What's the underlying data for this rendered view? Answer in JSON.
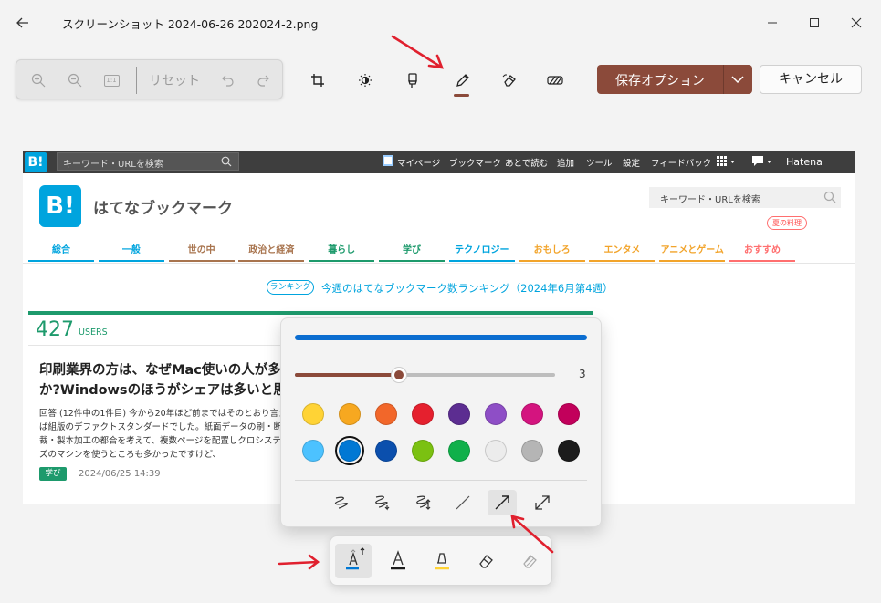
{
  "window": {
    "title": "スクリーンショット 2024-06-26 202024-2.png"
  },
  "zoom_bar": {
    "reset_label": "リセット",
    "fit_label": "1:1"
  },
  "toolbar": {
    "tools": [
      "crop-icon",
      "brightness-icon",
      "marker-icon",
      "pen-icon",
      "eraser-icon",
      "redact-icon"
    ],
    "save_label": "保存オプション",
    "cancel_label": "キャンセル",
    "accent": "#8b4a3a"
  },
  "page": {
    "header": {
      "logo": "B!",
      "search_placeholder": "キーワード・URLを検索",
      "links": [
        "マイページ",
        "ブックマーク",
        "あとで読む",
        "追加",
        "ツール",
        "設定",
        "フィードバック",
        "Hatena"
      ]
    },
    "site_logo": "B!",
    "site_title": "はてなブックマーク",
    "site_search": "キーワード・URLを検索",
    "categories": [
      {
        "label": "総合",
        "color": "#00a4de"
      },
      {
        "label": "一般",
        "color": "#00a4de"
      },
      {
        "label": "世の中",
        "color": "#a8744e"
      },
      {
        "label": "政治と経済",
        "color": "#a8744e"
      },
      {
        "label": "暮らし",
        "color": "#1d9a6c"
      },
      {
        "label": "学び",
        "color": "#1d9a6c"
      },
      {
        "label": "テクノロジー",
        "color": "#00a4de"
      },
      {
        "label": "おもしろ",
        "color": "#f2a42b"
      },
      {
        "label": "エンタメ",
        "color": "#f2a42b"
      },
      {
        "label": "アニメとゲーム",
        "color": "#f2a42b"
      },
      {
        "label": "おすすめ",
        "color": "#ff6f6f"
      }
    ],
    "category_badge": "夏の料理",
    "ranking_badge": "ランキング",
    "ranking_text": "今週のはてなブックマーク数ランキング（2024年6月第4週）",
    "article": {
      "users": "427",
      "users_label": "USERS",
      "title": "印刷業界の方は、なぜMac使いの人が多いのか?Windowsのほうがシェアは多いと思",
      "body": "回答 (12件中の1件目) 今から20年ほど前まではそのとおり言えば組版のデファクトスタンダードでした。紙面データの刷・断裁・製本加工の都合を考えて、複数ページを配置しクロシステムズのマシンを使うところも多かったですけど、",
      "tag": "学び",
      "date": "2024/06/25 14:39"
    }
  },
  "flyout": {
    "size_value": "3",
    "size_fraction": 0.4,
    "preview_color": "#0b6dd0",
    "colors_row1": [
      "#ffd335",
      "#f7a820",
      "#f2672a",
      "#e5202e",
      "#5c2d91",
      "#8e4ec6",
      "#d4147f",
      "#c2005b"
    ],
    "colors_row2": [
      "#4cc2ff",
      "#0078d4",
      "#0b4fad",
      "#7bc111",
      "#10b04a",
      "#ececec",
      "#b5b5b5",
      "#1b1b1b"
    ],
    "selected_color": "#0078d4",
    "styles": [
      "squiggle",
      "squiggle-arrow-end",
      "squiggle-arrow-both",
      "line",
      "arrow",
      "double-arrow"
    ],
    "selected_style": "arrow"
  },
  "ink_tools": [
    "pen",
    "ballpoint",
    "highlighter",
    "eraser",
    "shape-eraser"
  ],
  "annotation_color": "#e0202e"
}
